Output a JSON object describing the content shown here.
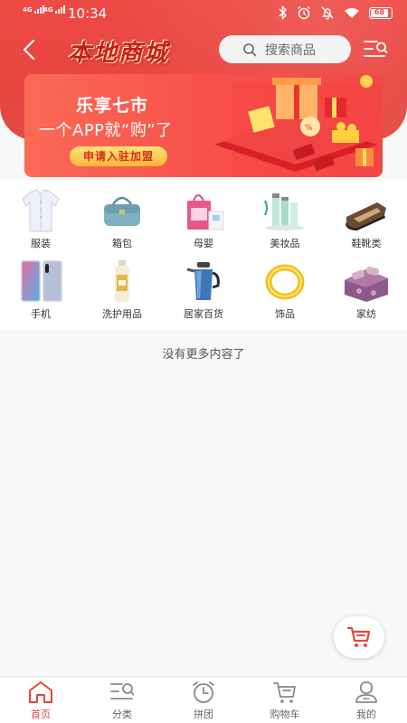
{
  "status_bar": {
    "network_1": "4G",
    "network_2": "4G",
    "time": "10:34",
    "battery": "68"
  },
  "header": {
    "title": "本地商城",
    "search_placeholder": "搜索商品"
  },
  "banner": {
    "line1": "乐享七市",
    "line2": "一个APP就“购”了",
    "button": "申请入驻加盟"
  },
  "categories": [
    {
      "label": "服装",
      "icon": "shirt-icon"
    },
    {
      "label": "箱包",
      "icon": "handbag-icon"
    },
    {
      "label": "母婴",
      "icon": "baby-bag-icon"
    },
    {
      "label": "美妆品",
      "icon": "cosmetics-icon"
    },
    {
      "label": "鞋靴类",
      "icon": "shoe-icon"
    },
    {
      "label": "手机",
      "icon": "phone-icon"
    },
    {
      "label": "洗护用品",
      "icon": "shampoo-icon"
    },
    {
      "label": "居家百货",
      "icon": "kettle-icon"
    },
    {
      "label": "饰品",
      "icon": "ring-icon"
    },
    {
      "label": "家纺",
      "icon": "bedding-icon"
    }
  ],
  "feed": {
    "end_text": "没有更多内容了"
  },
  "tabs": [
    {
      "label": "首页",
      "icon": "home-icon",
      "active": true
    },
    {
      "label": "分类",
      "icon": "category-icon",
      "active": false
    },
    {
      "label": "拼团",
      "icon": "clock-icon",
      "active": false
    },
    {
      "label": "购物车",
      "icon": "cart-icon",
      "active": false
    },
    {
      "label": "我的",
      "icon": "user-icon",
      "active": false
    }
  ],
  "colors": {
    "brand_red": "#e8453f",
    "title_red": "#c81c18",
    "button_yellow": "#ffd05a"
  }
}
